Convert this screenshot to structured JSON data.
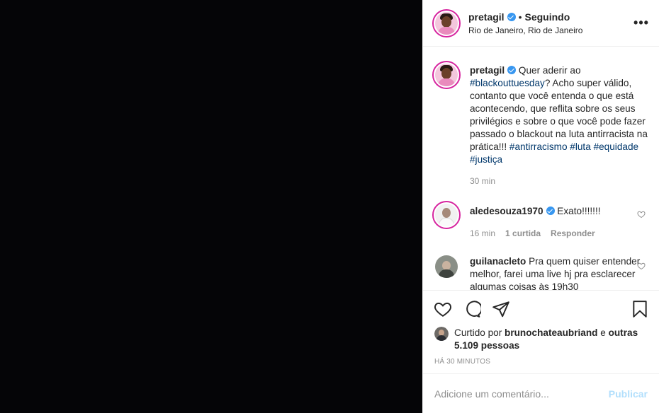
{
  "post": {
    "username": "pretagil",
    "following": "Seguindo",
    "dot": "•",
    "location": "Rio de Janeiro, Rio de Janeiro"
  },
  "caption": {
    "username": "pretagil",
    "text1": " Quer aderir ao ",
    "tag1": "#blackouttuesday",
    "text2": "? Acho super válido, contanto que você entenda o que está acontecendo, que reflita sobre os seus privilégios e sobre o que você pode fazer passado o blackout na luta antirracista na prática!!! ",
    "tag2": "#antirracismo",
    "tag3": "#luta",
    "tag4": "#equidade",
    "tag5": "#justiça",
    "time": "30 min"
  },
  "comments": [
    {
      "username": "aledesouza1970",
      "text": " Exato!!!!!!!",
      "time": "16 min",
      "likes": "1 curtida",
      "reply": "Responder"
    },
    {
      "username": "guilanacleto",
      "text": " Pra quem quiser entender melhor, farei uma live hj pra esclarecer algumas coisas às 19h30"
    }
  ],
  "likes": {
    "prefix": "Curtido por ",
    "user": "brunochateaubriand",
    "mid": " e ",
    "others": "outras 5.109 pessoas"
  },
  "timestamp": "HÁ 30 MINUTOS",
  "comment_box": {
    "placeholder": "Adicione um comentário...",
    "publish": "Publicar"
  },
  "icons": {
    "more": "more-options-icon",
    "like": "heart-icon",
    "comment": "comment-icon",
    "share": "share-icon",
    "save": "bookmark-icon"
  }
}
